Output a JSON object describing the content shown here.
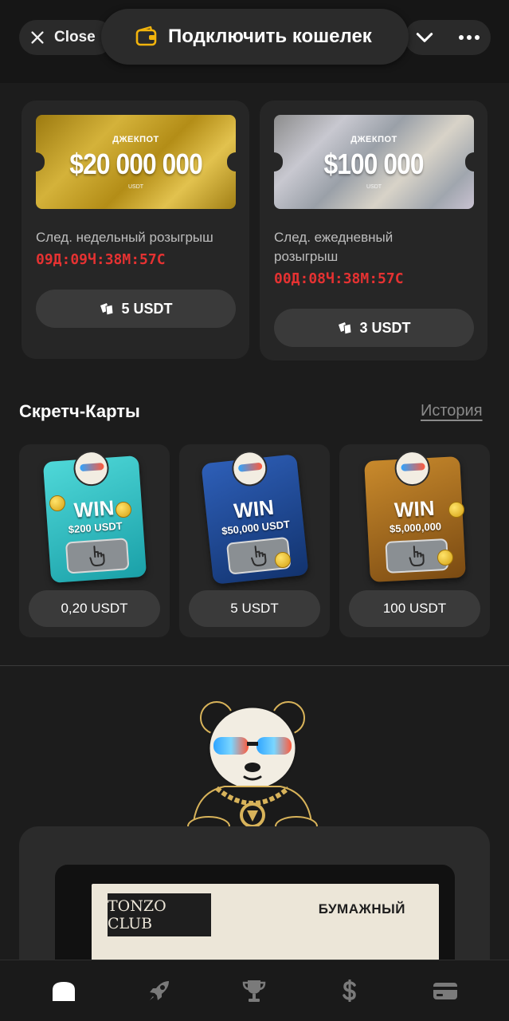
{
  "header": {
    "close_label": "Close",
    "connect_wallet_label": "Подключить кошелек"
  },
  "jackpots": [
    {
      "label": "ДЖЕКПОТ",
      "amount": "$20 000 000",
      "unit": "USDT",
      "next_draw_label": "След. недельный розыгрыш",
      "timer": "09Д:09Ч:38М:57С",
      "buy_label": "5 USDT"
    },
    {
      "label": "ДЖЕКПОТ",
      "amount": "$100 000",
      "unit": "USDT",
      "next_draw_label": "След. ежедневный розыгрыш",
      "timer": "00Д:08Ч:38М:57С",
      "buy_label": "3 USDT"
    }
  ],
  "scratch": {
    "title": "Скретч-Карты",
    "history_label": "История",
    "cards": [
      {
        "win_label": "WIN",
        "prize": "$200 USDT",
        "price": "0,20 USDT"
      },
      {
        "win_label": "WIN",
        "prize": "$50,000 USDT",
        "price": "5 USDT"
      },
      {
        "win_label": "WIN",
        "prize": "$5,000,000",
        "price": "100 USDT"
      }
    ]
  },
  "paper_ticket": {
    "club_logo_text": "TONZO CLUB",
    "label": "БУМАЖНЫЙ"
  },
  "nav": {
    "items": [
      "home-icon",
      "rocket-icon",
      "trophy-icon",
      "dollar-icon",
      "card-icon"
    ],
    "active": "home-icon"
  },
  "colors": {
    "timer": "#e53232",
    "background": "#1c1c1c",
    "card": "#262626"
  }
}
